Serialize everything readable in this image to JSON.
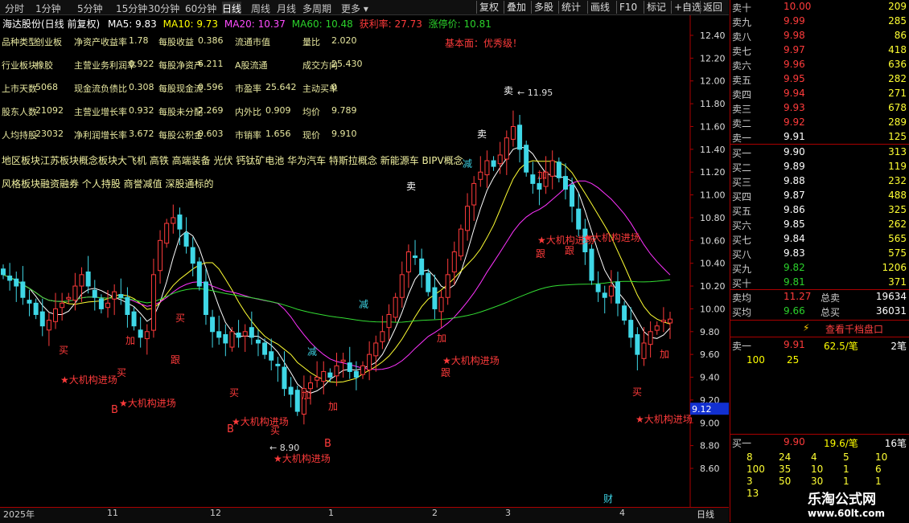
{
  "toolbar": {
    "left": [
      "分时",
      "1分钟",
      "5分钟",
      "15分钟",
      "30分钟",
      "60分钟",
      "日线",
      "周线",
      "月线",
      "多周期",
      "更多"
    ],
    "right": [
      "复权",
      "叠加",
      "多股",
      "统计",
      "画线",
      "F10",
      "标记",
      "+自选",
      "返回"
    ]
  },
  "header": {
    "title": "海达股份(日线 前复权)",
    "ma5": "MA5: 9.83",
    "ma10": "MA10: 9.73",
    "ma20": "MA20: 10.37",
    "ma60": "MA60: 10.48",
    "profit": "获利率: 27.73",
    "limit": "涨停价: 10.81",
    "fundamental": "基本面：优秀级！"
  },
  "fundamentals": [
    [
      "品种类型",
      "创业板",
      "净资产收益率",
      "1.78",
      "每股收益",
      "0.386",
      "流通市值",
      "",
      "量比",
      "2.020"
    ],
    [
      "行业板块",
      "橡胶",
      "主营业务利润率",
      "0.922",
      "每股净资产",
      "6.211",
      "A股流通",
      "",
      "成交方向",
      "25.430"
    ],
    [
      "上市天数",
      "5068",
      "现金流负债比",
      "0.308",
      "每股现金流",
      "0.596",
      "市盈率",
      "25.642",
      "主动买单",
      "0"
    ],
    [
      "股东人数",
      "21092",
      "主营业增长率",
      "0.932",
      "每股未分配",
      "2.269",
      "内外比",
      "0.909",
      "均价",
      "9.789"
    ],
    [
      "人均持股",
      "23032",
      "净利润增长率",
      "3.672",
      "每股公积金",
      "0.603",
      "市销率",
      "1.656",
      "现价",
      "9.910"
    ]
  ],
  "concept": "地区板块江苏板块概念板块大飞机 高铁 高端装备 光伏 钙钛矿电池 华为汽车 特斯拉概念 新能源车 BIPV概念",
  "style": "风格板块融资融券 个人持股 商誉减值 深股通标的",
  "chart_data": {
    "type": "candlestick",
    "ylim": [
      8.6,
      12.6
    ],
    "yticks": [
      12.4,
      12.2,
      12.0,
      11.8,
      11.6,
      11.4,
      11.2,
      11.0,
      10.8,
      10.6,
      10.4,
      10.2,
      10.0,
      9.8,
      9.6,
      9.4,
      9.2,
      9.0,
      8.8,
      8.6
    ],
    "ytick_labels": [
      "12.40",
      "12.20",
      "12.00",
      "11.80",
      "11.60",
      "11.40",
      "11.20",
      "11.00",
      "10.80",
      "10.60",
      "10.40",
      "10.20",
      "10.00",
      "9.80",
      "9.60",
      "9.40",
      "9.20",
      "9.00",
      "8.80",
      "8.60"
    ],
    "current_price": "9.12",
    "high_label": "11.95",
    "low_label": "8.90",
    "close": [
      10.3,
      10.25,
      10.2,
      10.1,
      10.05,
      9.95,
      9.85,
      9.9,
      10.0,
      10.05,
      10.1,
      10.2,
      10.3,
      10.2,
      10.1,
      10.0,
      10.05,
      10.15,
      10.1,
      9.95,
      9.85,
      9.75,
      9.8,
      10.3,
      10.6,
      10.75,
      10.8,
      10.7,
      10.55,
      10.4,
      10.2,
      9.95,
      9.8,
      9.75,
      9.7,
      9.8,
      9.75,
      9.8,
      9.75,
      9.7,
      9.6,
      9.55,
      9.5,
      9.3,
      9.25,
      9.1,
      9.3,
      9.35,
      9.4,
      9.45,
      9.4,
      9.5,
      9.55,
      9.45,
      9.4,
      9.5,
      9.6,
      9.7,
      9.8,
      9.95,
      10.1,
      10.3,
      10.5,
      10.45,
      10.3,
      10.15,
      10.0,
      10.1,
      10.3,
      10.5,
      10.7,
      10.9,
      11.1,
      11.2,
      11.3,
      11.25,
      11.35,
      11.5,
      11.6,
      11.4,
      11.2,
      11.1,
      11.05,
      11.2,
      11.3,
      11.15,
      11.05,
      10.9,
      10.7,
      10.5,
      10.25,
      10.15,
      10.1,
      10.2,
      10.05,
      9.9,
      9.75,
      9.6,
      9.7,
      9.8,
      9.85,
      9.9,
      9.91
    ],
    "x_labels": [
      "2025年",
      "11",
      "12",
      "1",
      "2",
      "3",
      "4"
    ],
    "ma_legend": [
      "MA5",
      "MA10",
      "MA20",
      "MA60"
    ],
    "ma_colors": [
      "#ffffff",
      "#ffff33",
      "#ff33ff",
      "#33dd33"
    ],
    "signals": [
      "★大机构进场",
      "★大机构进场",
      "★大机构进场",
      "★大机构进场",
      "★大机构进场",
      "★大机构进场",
      "★大机构进场",
      "★大机构进场"
    ],
    "marks": [
      "买",
      "加",
      "买",
      "跟",
      "买",
      "买",
      "买",
      "加",
      "加",
      "减",
      "减",
      "跟",
      "加",
      "减",
      "卖",
      "卖",
      "卖",
      "加",
      "跟",
      "跟",
      "买",
      "加",
      "财",
      "B",
      "B",
      "B"
    ],
    "period_label": "日线"
  },
  "orderbook": {
    "asks": [
      [
        "卖十",
        "10.00",
        "209"
      ],
      [
        "卖九",
        "9.99",
        "285"
      ],
      [
        "卖八",
        "9.98",
        "86"
      ],
      [
        "卖七",
        "9.97",
        "418"
      ],
      [
        "卖六",
        "9.96",
        "636"
      ],
      [
        "卖五",
        "9.95",
        "282"
      ],
      [
        "卖四",
        "9.94",
        "271"
      ],
      [
        "卖三",
        "9.93",
        "678"
      ],
      [
        "卖二",
        "9.92",
        "289"
      ],
      [
        "卖一",
        "9.91",
        "125"
      ]
    ],
    "bids": [
      [
        "买一",
        "9.90",
        "313"
      ],
      [
        "买二",
        "9.89",
        "119"
      ],
      [
        "买三",
        "9.88",
        "232"
      ],
      [
        "买四",
        "9.87",
        "488"
      ],
      [
        "买五",
        "9.86",
        "325"
      ],
      [
        "买六",
        "9.85",
        "262"
      ],
      [
        "买七",
        "9.84",
        "565"
      ],
      [
        "买八",
        "9.83",
        "575"
      ],
      [
        "买九",
        "9.82",
        "1206"
      ],
      [
        "买十",
        "9.81",
        "371"
      ]
    ],
    "avg_sell_label": "卖均",
    "avg_sell": "11.27",
    "total_sell_label": "总卖",
    "total_sell": "19634",
    "avg_buy_label": "买均",
    "avg_buy": "9.66",
    "total_buy_label": "总买",
    "total_buy": "36031",
    "thousand_link": "查看千档盘口",
    "sell1": [
      "卖一",
      "9.91",
      "62.5/笔",
      "2笔"
    ],
    "sell1_detail": [
      "100",
      "25"
    ],
    "buy1": [
      "买一",
      "9.90",
      "19.6/笔",
      "16笔"
    ],
    "buy1_detail": [
      [
        "8",
        "24",
        "4",
        "5",
        "10"
      ],
      [
        "100",
        "35",
        "10",
        "1",
        "6"
      ],
      [
        "3",
        "50",
        "30",
        "1",
        "1"
      ],
      [
        "13",
        "",
        "",
        "",
        ""
      ]
    ],
    "watermark": "乐淘公式网",
    "watermark_url": "www.60lt.com"
  }
}
